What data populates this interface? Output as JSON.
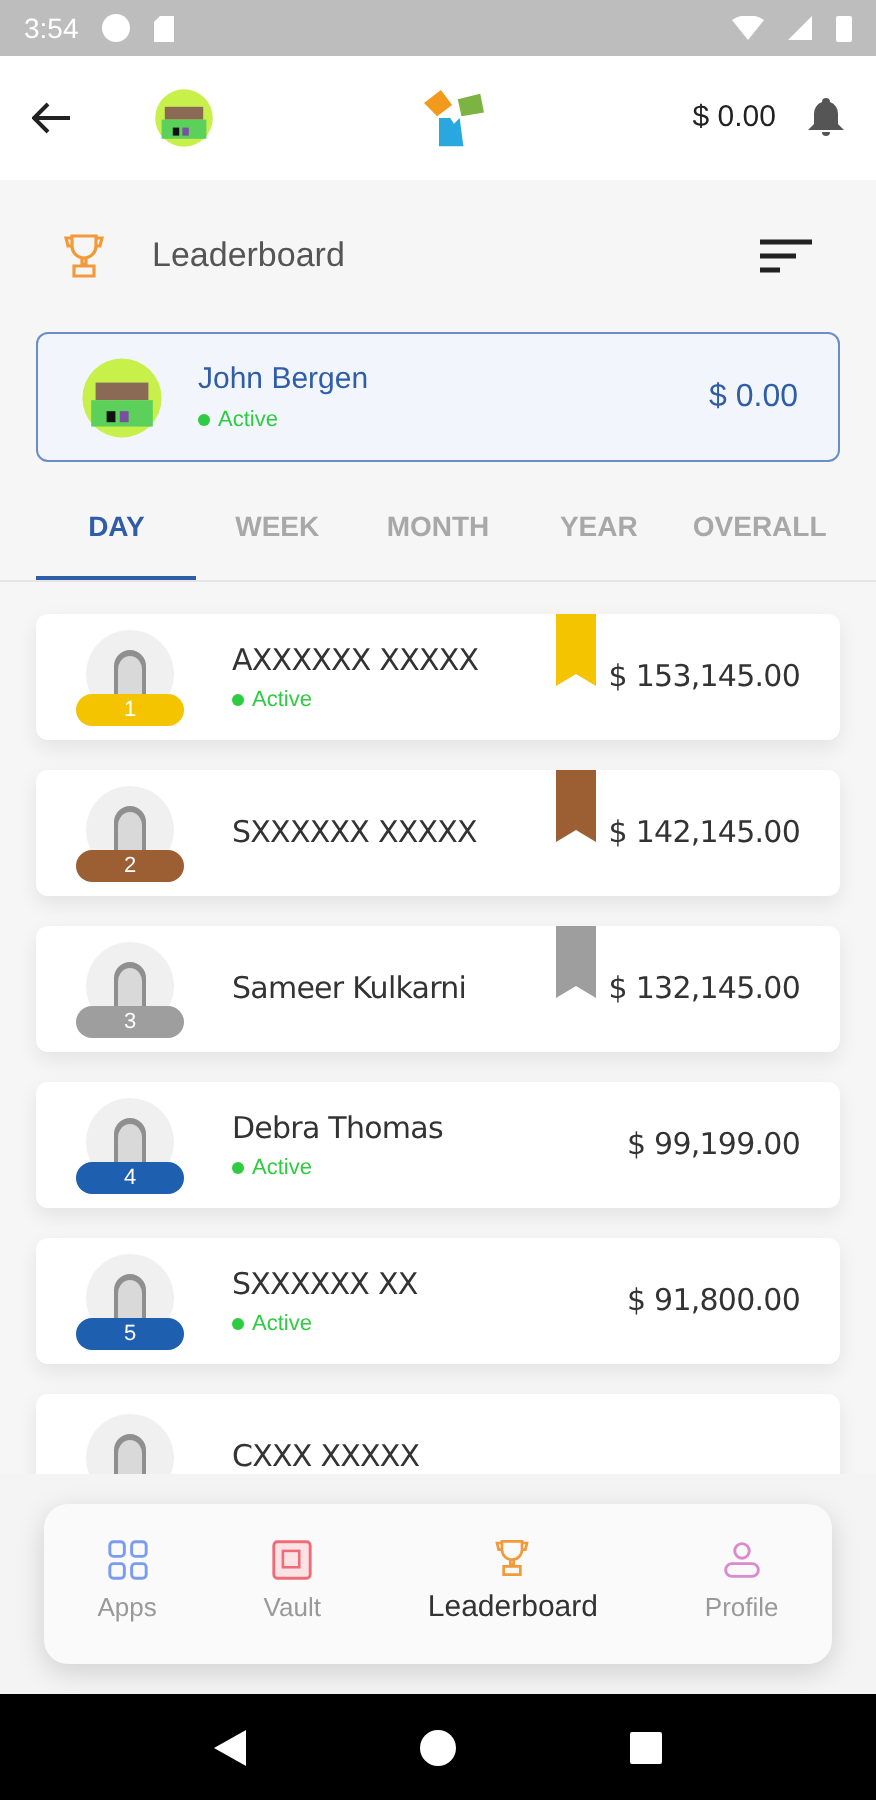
{
  "status_bar": {
    "time": "3:54"
  },
  "header": {
    "balance": "$ 0.00"
  },
  "section": {
    "title": "Leaderboard"
  },
  "current_user": {
    "name": "John Bergen",
    "status": "Active",
    "amount": "$ 0.00"
  },
  "tabs": [
    {
      "label": "DAY",
      "selected": true
    },
    {
      "label": "WEEK",
      "selected": false
    },
    {
      "label": "MONTH",
      "selected": false
    },
    {
      "label": "YEAR",
      "selected": false
    },
    {
      "label": "OVERALL",
      "selected": false
    }
  ],
  "leaders": [
    {
      "rank": "1",
      "name": "AXXXXXX XXXXX",
      "status": "Active",
      "amount": "$ 153,145.00",
      "color": "#f5c400",
      "ribbon": true
    },
    {
      "rank": "2",
      "name": "SXXXXXX XXXXX",
      "amount": "$ 142,145.00",
      "color": "#9c5f34",
      "ribbon": true
    },
    {
      "rank": "3",
      "name": "Sameer Kulkarni",
      "amount": "$ 132,145.00",
      "color": "#9e9e9e",
      "ribbon": true
    },
    {
      "rank": "4",
      "name": "Debra Thomas",
      "status": "Active",
      "amount": "$ 99,199.00",
      "color": "#1e5fb0",
      "ribbon": false
    },
    {
      "rank": "5",
      "name": "SXXXXXX XX",
      "status": "Active",
      "amount": "$ 91,800.00",
      "color": "#1e5fb0",
      "ribbon": false
    },
    {
      "name": "CXXX XXXXX",
      "ribbon": false
    }
  ],
  "bottom_nav": [
    {
      "label": "Apps",
      "selected": false
    },
    {
      "label": "Vault",
      "selected": false
    },
    {
      "label": "Leaderboard",
      "selected": true
    },
    {
      "label": "Profile",
      "selected": false
    }
  ]
}
